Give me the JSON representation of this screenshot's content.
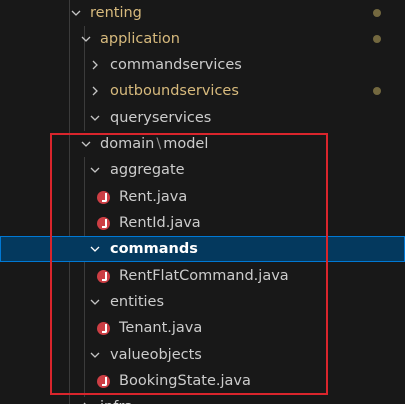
{
  "explorer": {
    "items": [
      {
        "label": "renting",
        "type": "folder-open",
        "modified": true,
        "dot": true
      },
      {
        "label": "application",
        "type": "folder-open",
        "modified": true,
        "dot": true
      },
      {
        "label": "commandservices",
        "type": "folder-closed"
      },
      {
        "label": "outboundservices",
        "type": "folder-closed",
        "modified": true,
        "dot": true
      },
      {
        "label": "queryservices",
        "type": "folder-open"
      },
      {
        "label_parts": [
          "domain",
          "\\",
          "model"
        ],
        "type": "folder-open"
      },
      {
        "label": "aggregate",
        "type": "folder-open"
      },
      {
        "label": "Rent.java",
        "type": "java-file",
        "icon": "java-icon"
      },
      {
        "label": "RentId.java",
        "type": "java-file",
        "icon": "java-icon"
      },
      {
        "label": "commands",
        "type": "folder-open",
        "selected": true
      },
      {
        "label": "RentFlatCommand.java",
        "type": "java-file",
        "icon": "java-icon"
      },
      {
        "label": "entities",
        "type": "folder-open"
      },
      {
        "label": "Tenant.java",
        "type": "java-file",
        "icon": "java-icon"
      },
      {
        "label": "valueobjects",
        "type": "folder-open"
      },
      {
        "label": "BookingState.java",
        "type": "java-file",
        "icon": "java-icon"
      },
      {
        "label": "infra",
        "type": "folder-closed",
        "partial": true
      }
    ]
  },
  "colors": {
    "background": "#181818",
    "text": "#cccccc",
    "modified_text": "#d7ba7d",
    "selection_bg": "#04395e",
    "selection_border": "#0078d4",
    "java_icon": "#cc3e44",
    "annotation_box": "#d9252c",
    "modified_dot": "#73683f"
  }
}
